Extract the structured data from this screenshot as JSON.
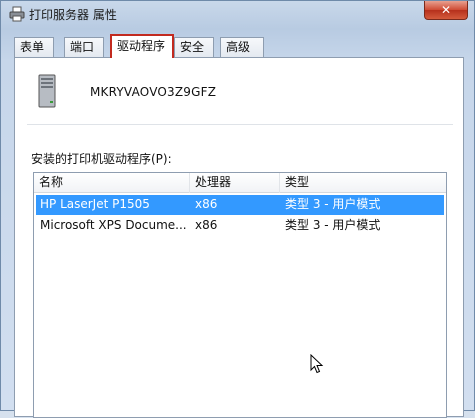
{
  "window": {
    "title": "打印服务器 属性",
    "close_label": "✕"
  },
  "tabs": [
    {
      "label": "表单"
    },
    {
      "label": "端口"
    },
    {
      "label": "驱动程序"
    },
    {
      "label": "安全"
    },
    {
      "label": "高级"
    }
  ],
  "active_tab": "驱动程序",
  "server": {
    "name": "MKRYVAOVO3Z9GFZ",
    "icon": "server-tower-icon"
  },
  "drivers": {
    "label": "安装的打印机驱动程序(P):",
    "columns": [
      "名称",
      "处理器",
      "类型"
    ],
    "rows": [
      {
        "name": "HP LaserJet P1505",
        "processor": "x86",
        "type": "类型 3 - 用户模式",
        "selected": true
      },
      {
        "name": "Microsoft XPS Docume...",
        "processor": "x86",
        "type": "类型 3 - 用户模式",
        "selected": false
      }
    ]
  },
  "colors": {
    "selection": "#3399ff",
    "active_tab_highlight": "#c22a1f",
    "close_button": "#cf4a33"
  }
}
